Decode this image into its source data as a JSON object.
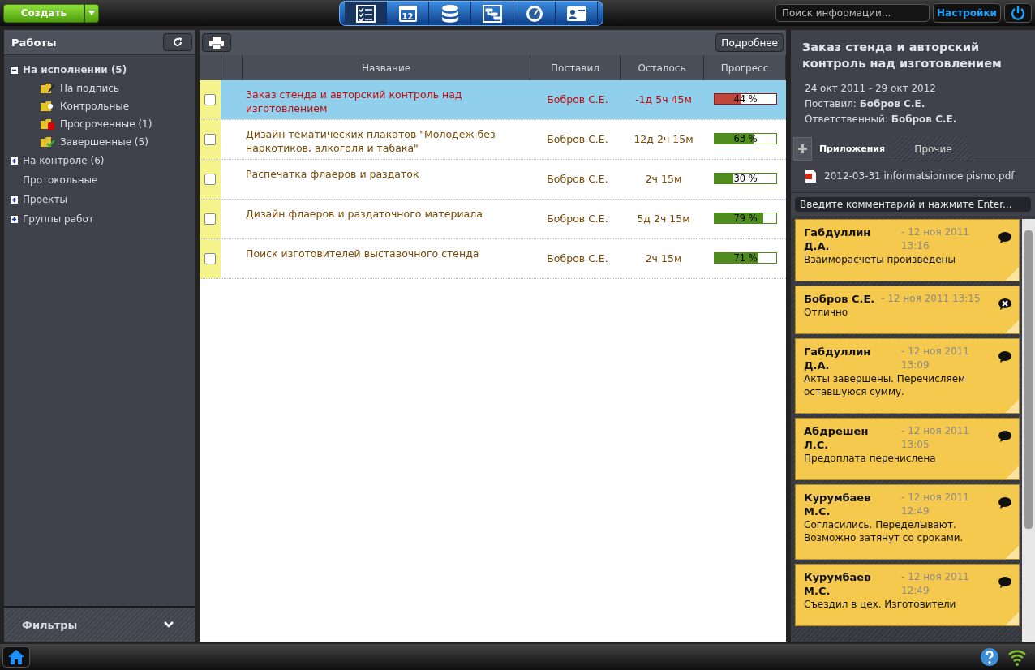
{
  "topbar": {
    "create_button": "Создать",
    "nav": [
      {
        "kind": "tasks",
        "selected": true
      },
      {
        "kind": "calendar",
        "label": "12",
        "selected": false
      },
      {
        "kind": "database",
        "selected": false
      },
      {
        "kind": "structure",
        "selected": false
      },
      {
        "kind": "gauge",
        "selected": false
      },
      {
        "kind": "contact",
        "selected": false
      }
    ],
    "search": {
      "placeholder": "Поиск информации..."
    },
    "settings_button": "Настройки"
  },
  "sidebar": {
    "title": "Работы",
    "items": [
      {
        "label": "На исполнении (5)",
        "kind": "group",
        "expanded": true,
        "selected": true,
        "children": [
          {
            "label": "На подпись",
            "kind": "sign"
          },
          {
            "label": "Контрольные",
            "kind": "control"
          },
          {
            "label": "Просроченные (1)",
            "kind": "overdue"
          },
          {
            "label": "Завершенные (5)",
            "kind": "done"
          }
        ]
      },
      {
        "label": "На контроле (6)",
        "kind": "group",
        "expanded": false,
        "selected": false
      },
      {
        "label": "Протокольные",
        "kind": "leaf",
        "selected": false
      },
      {
        "label": "Проекты",
        "kind": "group",
        "expanded": false,
        "selected": false
      },
      {
        "label": "Группы работ",
        "kind": "group",
        "expanded": false,
        "selected": false
      }
    ],
    "filters": "Фильтры"
  },
  "toolbar": {
    "details_button": "Подробнее"
  },
  "table": {
    "columns": [
      "Название",
      "Поставил",
      "Осталось",
      "Прогресс"
    ],
    "rows": [
      {
        "title": "Заказ стенда и авторский контроль над изготовлением",
        "author": "Бобров С.Е.",
        "left": "-1д 5ч 45м",
        "progress": "44 %",
        "level": 0.44,
        "checked": false,
        "selected": true,
        "overdue": true
      },
      {
        "title": "Дизайн тематических плакатов \"Молодеж без наркотиков, алкоголя и табака\"",
        "author": "Бобров С.Е.",
        "left": "12д 2ч 15м",
        "progress": "63 %",
        "level": 0.63,
        "checked": false,
        "selected": false,
        "overdue": false
      },
      {
        "title": "Распечатка флаеров и раздаток",
        "author": "Бобров С.Е.",
        "left": "2ч 15м",
        "progress": "30 %",
        "level": 0.3,
        "checked": false,
        "selected": false,
        "overdue": false
      },
      {
        "title": "Дизайн флаеров и раздаточного материала",
        "author": "Бобров С.Е.",
        "left": "5д 2ч 15м",
        "progress": "79 %",
        "level": 0.79,
        "checked": false,
        "selected": false,
        "overdue": false
      },
      {
        "title": "Поиск изготовителей выставочного стенда",
        "author": "Бобров С.Е.",
        "left": "2ч 15м",
        "progress": "71 %",
        "level": 0.71,
        "checked": false,
        "selected": false,
        "overdue": false
      }
    ]
  },
  "details": {
    "title": "Заказ стенда и авторский контроль над изготовлением",
    "dates": "24 окт 2011 - 29 окт 2012",
    "fields": [
      {
        "label": "Поставил:",
        "value": "Бобров С.Е."
      },
      {
        "label": "Ответственный:",
        "value": "Бобров С.Е."
      }
    ],
    "tabs": [
      {
        "label": "Приложения",
        "selected": true
      },
      {
        "label": "Прочие",
        "selected": false
      }
    ],
    "attachments": [
      "2012-03-31 informatsionnoe pismo.pdf"
    ],
    "comment_field": {
      "placeholder": "Введите комментарий и нажмите Enter..."
    },
    "comments": [
      {
        "author": "Габдуллин Д.А.",
        "date": "- 12 ноя 2011 13:16",
        "text": "Взаиморасчеты произведены",
        "kind": "reply"
      },
      {
        "author": "Бобров С.Е.",
        "date": "- 12 ноя 2011 13:15",
        "text": "Отлично",
        "kind": "remove"
      },
      {
        "author": "Габдуллин Д.А.",
        "date": "- 12 ноя 2011 13:09",
        "text": "Акты завершены. Перечисляем оставшуюся сумму.",
        "kind": "reply"
      },
      {
        "author": "Абдрешен Л.С.",
        "date": "- 12 ноя 2011 13:05",
        "text": "Предоплата перечислена",
        "kind": "reply"
      },
      {
        "author": "Курумбаев М.С.",
        "date": "- 12 ноя 2011 12:49",
        "text": "Согласились. Переделывают. Возможно затянут со сроками.",
        "kind": "reply"
      },
      {
        "author": "Курумбаев М.С.",
        "date": "- 12 ноя 2011 12:49",
        "text": "Съездил в цех. Изготовители",
        "kind": "reply"
      }
    ]
  }
}
